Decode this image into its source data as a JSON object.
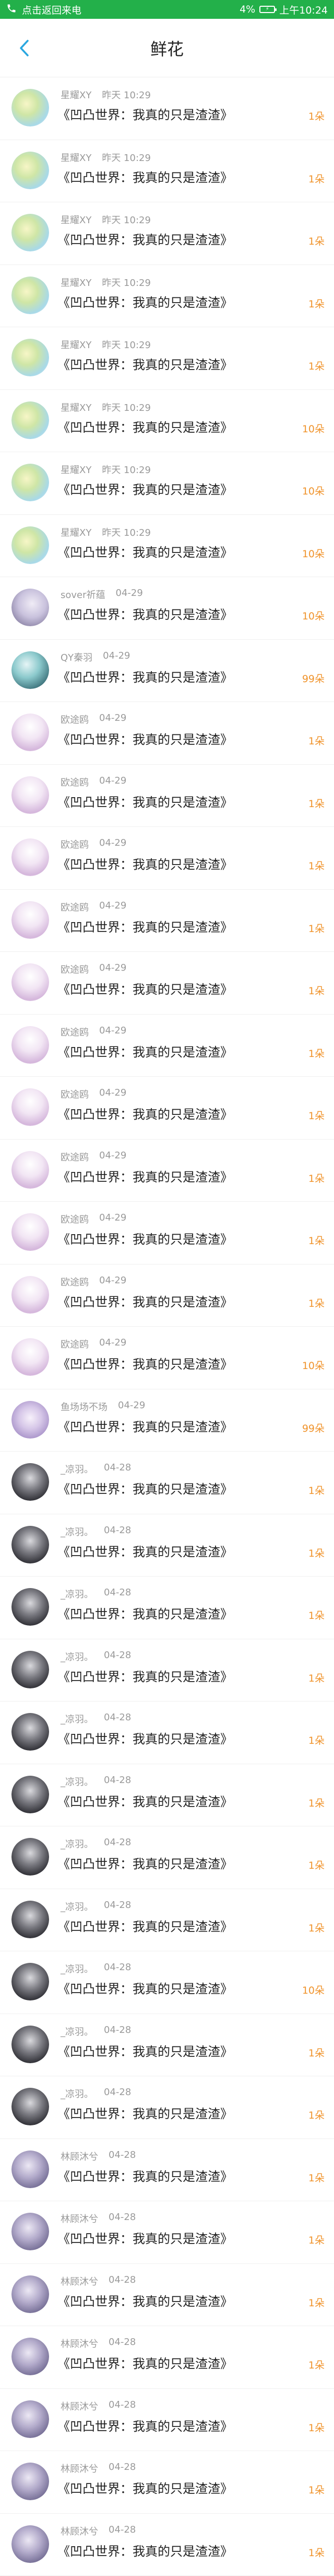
{
  "status_bar": {
    "notice": "点击返回来电",
    "battery_percent": "4%",
    "time": "上午10:24",
    "bg_color": "#23b04a"
  },
  "header": {
    "title": "鲜花",
    "back_icon": "chevron-left-icon"
  },
  "rows": [
    {
      "name": "星耀XY",
      "time": "昨天 10:29",
      "title": "《凹凸世界：我真的只是渣渣》",
      "amount": "1朵",
      "avatar": "av-leaf"
    },
    {
      "name": "星耀XY",
      "time": "昨天 10:29",
      "title": "《凹凸世界：我真的只是渣渣》",
      "amount": "1朵",
      "avatar": "av-leaf"
    },
    {
      "name": "星耀XY",
      "time": "昨天 10:29",
      "title": "《凹凸世界：我真的只是渣渣》",
      "amount": "1朵",
      "avatar": "av-leaf"
    },
    {
      "name": "星耀XY",
      "time": "昨天 10:29",
      "title": "《凹凸世界：我真的只是渣渣》",
      "amount": "1朵",
      "avatar": "av-leaf"
    },
    {
      "name": "星耀XY",
      "time": "昨天 10:29",
      "title": "《凹凸世界：我真的只是渣渣》",
      "amount": "1朵",
      "avatar": "av-leaf"
    },
    {
      "name": "星耀XY",
      "time": "昨天 10:29",
      "title": "《凹凸世界：我真的只是渣渣》",
      "amount": "10朵",
      "avatar": "av-leaf"
    },
    {
      "name": "星耀XY",
      "time": "昨天 10:29",
      "title": "《凹凸世界：我真的只是渣渣》",
      "amount": "10朵",
      "avatar": "av-leaf"
    },
    {
      "name": "星耀XY",
      "time": "昨天 10:29",
      "title": "《凹凸世界：我真的只是渣渣》",
      "amount": "10朵",
      "avatar": "av-leaf"
    },
    {
      "name": "sover祈蕴",
      "time": "04-29",
      "title": "《凹凸世界：我真的只是渣渣》",
      "amount": "10朵",
      "avatar": "av-girl"
    },
    {
      "name": "QY秦羽",
      "time": "04-29",
      "title": "《凹凸世界：我真的只是渣渣》",
      "amount": "99朵",
      "avatar": "av-teal"
    },
    {
      "name": "欧途鸥",
      "time": "04-29",
      "title": "《凹凸世界：我真的只是渣渣》",
      "amount": "1朵",
      "avatar": "av-pink"
    },
    {
      "name": "欧途鸥",
      "time": "04-29",
      "title": "《凹凸世界：我真的只是渣渣》",
      "amount": "1朵",
      "avatar": "av-pink"
    },
    {
      "name": "欧途鸥",
      "time": "04-29",
      "title": "《凹凸世界：我真的只是渣渣》",
      "amount": "1朵",
      "avatar": "av-pink"
    },
    {
      "name": "欧途鸥",
      "time": "04-29",
      "title": "《凹凸世界：我真的只是渣渣》",
      "amount": "1朵",
      "avatar": "av-pink"
    },
    {
      "name": "欧途鸥",
      "time": "04-29",
      "title": "《凹凸世界：我真的只是渣渣》",
      "amount": "1朵",
      "avatar": "av-pink"
    },
    {
      "name": "欧途鸥",
      "time": "04-29",
      "title": "《凹凸世界：我真的只是渣渣》",
      "amount": "1朵",
      "avatar": "av-pink"
    },
    {
      "name": "欧途鸥",
      "time": "04-29",
      "title": "《凹凸世界：我真的只是渣渣》",
      "amount": "1朵",
      "avatar": "av-pink"
    },
    {
      "name": "欧途鸥",
      "time": "04-29",
      "title": "《凹凸世界：我真的只是渣渣》",
      "amount": "1朵",
      "avatar": "av-pink"
    },
    {
      "name": "欧途鸥",
      "time": "04-29",
      "title": "《凹凸世界：我真的只是渣渣》",
      "amount": "1朵",
      "avatar": "av-pink"
    },
    {
      "name": "欧途鸥",
      "time": "04-29",
      "title": "《凹凸世界：我真的只是渣渣》",
      "amount": "1朵",
      "avatar": "av-pink"
    },
    {
      "name": "欧途鸥",
      "time": "04-29",
      "title": "《凹凸世界：我真的只是渣渣》",
      "amount": "10朵",
      "avatar": "av-pink"
    },
    {
      "name": "鱼场场不场",
      "time": "04-29",
      "title": "《凹凸世界：我真的只是渣渣》",
      "amount": "99朵",
      "avatar": "av-purple"
    },
    {
      "name": "_凉羽。",
      "time": "04-28",
      "title": "《凹凸世界：我真的只是渣渣》",
      "amount": "1朵",
      "avatar": "av-dark"
    },
    {
      "name": "_凉羽。",
      "time": "04-28",
      "title": "《凹凸世界：我真的只是渣渣》",
      "amount": "1朵",
      "avatar": "av-dark"
    },
    {
      "name": "_凉羽。",
      "time": "04-28",
      "title": "《凹凸世界：我真的只是渣渣》",
      "amount": "1朵",
      "avatar": "av-dark"
    },
    {
      "name": "_凉羽。",
      "time": "04-28",
      "title": "《凹凸世界：我真的只是渣渣》",
      "amount": "1朵",
      "avatar": "av-dark"
    },
    {
      "name": "_凉羽。",
      "time": "04-28",
      "title": "《凹凸世界：我真的只是渣渣》",
      "amount": "1朵",
      "avatar": "av-dark"
    },
    {
      "name": "_凉羽。",
      "time": "04-28",
      "title": "《凹凸世界：我真的只是渣渣》",
      "amount": "1朵",
      "avatar": "av-dark"
    },
    {
      "name": "_凉羽。",
      "time": "04-28",
      "title": "《凹凸世界：我真的只是渣渣》",
      "amount": "1朵",
      "avatar": "av-dark"
    },
    {
      "name": "_凉羽。",
      "time": "04-28",
      "title": "《凹凸世界：我真的只是渣渣》",
      "amount": "1朵",
      "avatar": "av-dark"
    },
    {
      "name": "_凉羽。",
      "time": "04-28",
      "title": "《凹凸世界：我真的只是渣渣》",
      "amount": "10朵",
      "avatar": "av-dark"
    },
    {
      "name": "_凉羽。",
      "time": "04-28",
      "title": "《凹凸世界：我真的只是渣渣》",
      "amount": "1朵",
      "avatar": "av-dark"
    },
    {
      "name": "_凉羽。",
      "time": "04-28",
      "title": "《凹凸世界：我真的只是渣渣》",
      "amount": "1朵",
      "avatar": "av-dark"
    },
    {
      "name": "林顾沐兮",
      "time": "04-28",
      "title": "《凹凸世界：我真的只是渣渣》",
      "amount": "1朵",
      "avatar": "av-lavender"
    },
    {
      "name": "林顾沐兮",
      "time": "04-28",
      "title": "《凹凸世界：我真的只是渣渣》",
      "amount": "1朵",
      "avatar": "av-lavender"
    },
    {
      "name": "林顾沐兮",
      "time": "04-28",
      "title": "《凹凸世界：我真的只是渣渣》",
      "amount": "1朵",
      "avatar": "av-lavender"
    },
    {
      "name": "林顾沐兮",
      "time": "04-28",
      "title": "《凹凸世界：我真的只是渣渣》",
      "amount": "1朵",
      "avatar": "av-lavender"
    },
    {
      "name": "林顾沐兮",
      "time": "04-28",
      "title": "《凹凸世界：我真的只是渣渣》",
      "amount": "1朵",
      "avatar": "av-lavender"
    },
    {
      "name": "林顾沐兮",
      "time": "04-28",
      "title": "《凹凸世界：我真的只是渣渣》",
      "amount": "1朵",
      "avatar": "av-lavender"
    },
    {
      "name": "林顾沐兮",
      "time": "04-28",
      "title": "《凹凸世界：我真的只是渣渣》",
      "amount": "1朵",
      "avatar": "av-lavender"
    }
  ]
}
